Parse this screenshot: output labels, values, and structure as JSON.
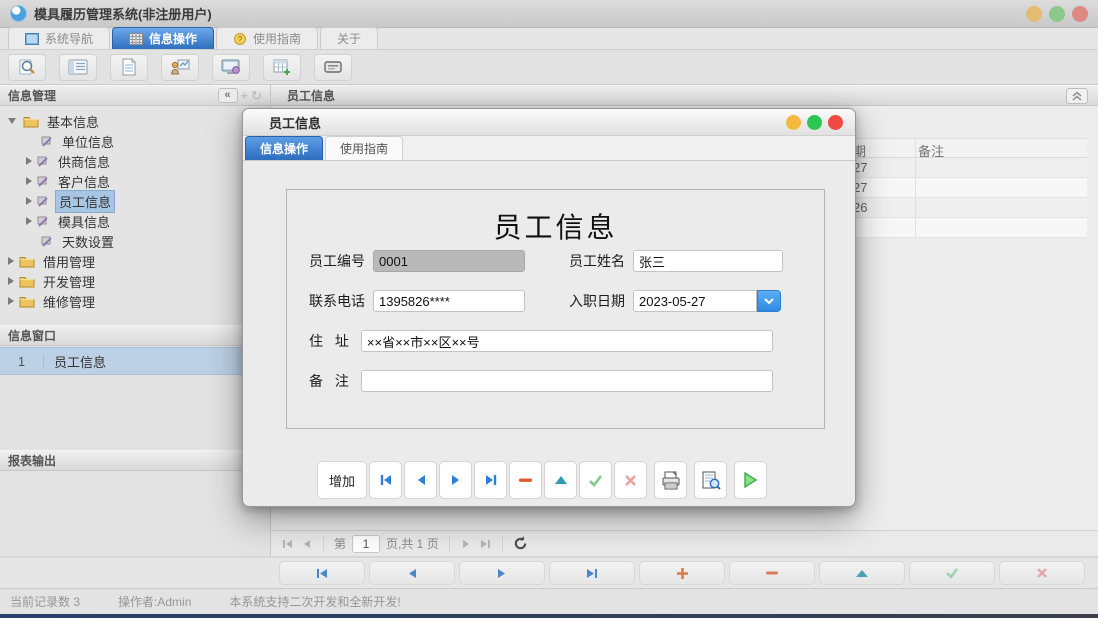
{
  "window": {
    "title": "模具履历管理系统(非注册用户)",
    "traffic_lights": {
      "yellow": "#e2bd71",
      "green": "#8cc88c",
      "red": "#dd8a85"
    }
  },
  "tabs": [
    {
      "label": "系统导航"
    },
    {
      "label": "信息操作",
      "active": true
    },
    {
      "label": "使用指南"
    },
    {
      "label": "关于"
    }
  ],
  "toolbar": {
    "icons": [
      "search-icon",
      "list-icon",
      "document-icon",
      "user-chart-icon",
      "monitor-icon",
      "table-add-icon",
      "device-icon"
    ]
  },
  "accent": {
    "tab_blue": "#2f6fbe",
    "combo_blue": "#3f96f0"
  },
  "sidebar": {
    "panel1_title": "信息管理",
    "collapse_icon": "«",
    "tree": [
      {
        "label": "基本信息"
      },
      {
        "label": "单位信息"
      },
      {
        "label": "供商信息"
      },
      {
        "label": "客户信息"
      },
      {
        "label": "员工信息"
      },
      {
        "label": "模具信息"
      },
      {
        "label": "天数设置"
      },
      {
        "label": "借用管理"
      },
      {
        "label": "开发管理"
      },
      {
        "label": "维修管理"
      }
    ],
    "panel2_title": "信息窗口",
    "window_list": [
      {
        "index": "1",
        "label": "员工信息"
      }
    ],
    "panel3_title": "报表输出"
  },
  "main": {
    "panel_title": "员工信息",
    "table": {
      "visible_header_fragment": "期",
      "header_col2": "备注",
      "visible_cell_fragments": [
        "27",
        "27",
        "26"
      ]
    },
    "pagination": {
      "prefix": "第",
      "page_value": "1",
      "suffix": "页,共 1 页"
    }
  },
  "dialog": {
    "title": "员工信息",
    "traffic_lights": {
      "yellow": "#f6b93f",
      "green": "#2dc653",
      "red": "#f04a42"
    },
    "tabs": [
      {
        "label": "信息操作",
        "active": true
      },
      {
        "label": "使用指南"
      }
    ],
    "form": {
      "title": "员工信息",
      "fields": [
        {
          "label": "员工编号",
          "value": "0001"
        },
        {
          "label": "员工姓名",
          "value": "张三"
        },
        {
          "label": "联系电话",
          "value": "1395826****"
        },
        {
          "label": "入职日期",
          "value": "2023-05-27"
        },
        {
          "label": "住 址",
          "value": "××省××市××区××号"
        },
        {
          "label": "备 注",
          "value": ""
        }
      ]
    },
    "buttons": {
      "add_label": "增加"
    }
  },
  "statusbar": {
    "record_count": "当前记录数 3",
    "operator": "操作者:Admin",
    "message": "本系统支持二次开发和全新开发!"
  }
}
